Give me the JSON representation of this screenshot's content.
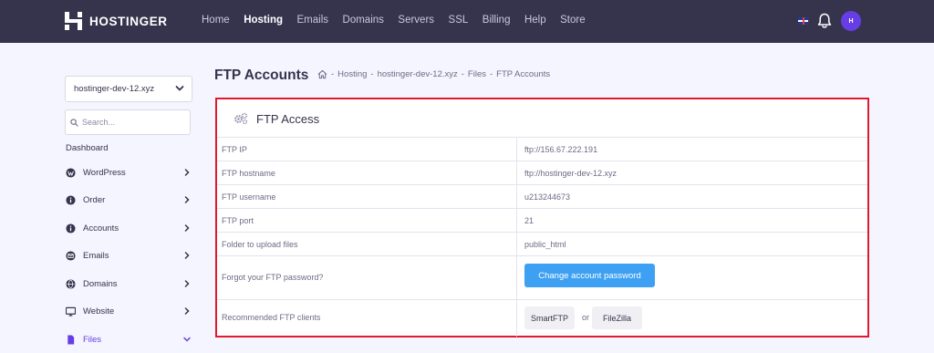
{
  "brand": {
    "name": "HOSTINGER"
  },
  "nav": {
    "items": [
      {
        "label": "Home",
        "active": false
      },
      {
        "label": "Hosting",
        "active": true
      },
      {
        "label": "Emails",
        "active": false
      },
      {
        "label": "Domains",
        "active": false
      },
      {
        "label": "Servers",
        "active": false
      },
      {
        "label": "SSL",
        "active": false
      },
      {
        "label": "Billing",
        "active": false
      },
      {
        "label": "Help",
        "active": false
      },
      {
        "label": "Store",
        "active": false
      }
    ],
    "avatar_text": "H",
    "accent_color": "#673de6",
    "bar_color": "#36344d"
  },
  "sidebar": {
    "domain": "hostinger-dev-12.xyz",
    "search_placeholder": "Search...",
    "heading": "Dashboard",
    "items": [
      {
        "label": "WordPress",
        "icon": "wordpress-icon"
      },
      {
        "label": "Order",
        "icon": "info-icon"
      },
      {
        "label": "Accounts",
        "icon": "info-icon"
      },
      {
        "label": "Emails",
        "icon": "email-icon"
      },
      {
        "label": "Domains",
        "icon": "globe-icon"
      },
      {
        "label": "Website",
        "icon": "monitor-icon"
      },
      {
        "label": "Files",
        "icon": "file-icon",
        "active": true
      }
    ]
  },
  "main": {
    "title": "FTP Accounts",
    "breadcrumb": [
      "-",
      "Hosting",
      "-",
      "hostinger-dev-12.xyz",
      "-",
      "Files",
      "-",
      "FTP Accounts"
    ],
    "panel": {
      "title": "FTP Access",
      "border_color": "#e0192d",
      "rows": [
        {
          "label": "FTP IP",
          "value": "ftp://156.67.222.191"
        },
        {
          "label": "FTP hostname",
          "value": "ftp://hostinger-dev-12.xyz"
        },
        {
          "label": "FTP username",
          "value": "u213244673"
        },
        {
          "label": "FTP port",
          "value": "21"
        },
        {
          "label": "Folder to upload files",
          "value": "public_html"
        }
      ],
      "password_row": {
        "label": "Forgot your FTP password?",
        "button": "Change account password",
        "button_color": "#3ea0f2"
      },
      "clients_row": {
        "label": "Recommended FTP clients",
        "client1": "SmartFTP",
        "or": "or",
        "client2": "FileZilla"
      }
    }
  }
}
